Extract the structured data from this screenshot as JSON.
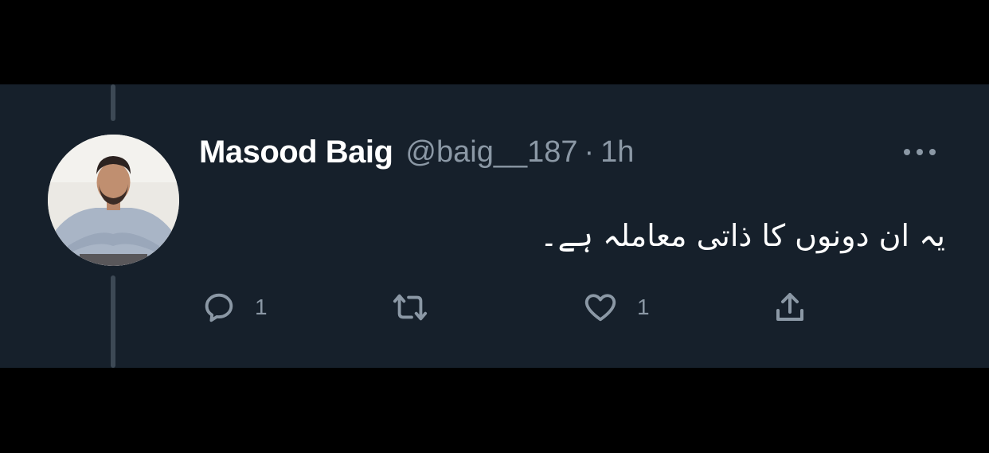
{
  "tweet": {
    "author_name": "Masood Baig",
    "handle": "@baig__187",
    "separator": "·",
    "time": "1h",
    "text": "یہ ان دونوں کا ذاتی معاملہ ہے۔",
    "actions": {
      "reply_icon": "reply-icon",
      "reply_count": "1",
      "retweet_icon": "retweet-icon",
      "like_icon": "heart-icon",
      "like_count": "1",
      "share_icon": "share-icon"
    },
    "more_icon": "more-icon"
  },
  "colors": {
    "background": "#000000",
    "tweet_background": "#16202b",
    "primary_text": "#ffffff",
    "secondary_text": "#8b98a5",
    "thread_line": "#3d4955"
  }
}
